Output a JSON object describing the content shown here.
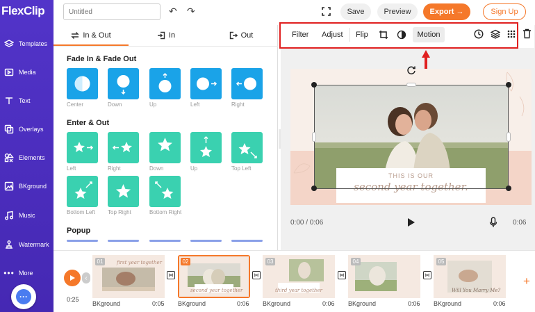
{
  "app": {
    "logo_text": "FlexClip"
  },
  "sidebar": {
    "items": [
      {
        "label": "Templates",
        "icon": "layers-icon"
      },
      {
        "label": "Media",
        "icon": "media-icon"
      },
      {
        "label": "Text",
        "icon": "text-icon"
      },
      {
        "label": "Overlays",
        "icon": "overlays-icon"
      },
      {
        "label": "Elements",
        "icon": "elements-icon"
      },
      {
        "label": "BKground",
        "icon": "background-icon"
      },
      {
        "label": "Music",
        "icon": "music-icon"
      },
      {
        "label": "Watermark",
        "icon": "watermark-icon"
      },
      {
        "label": "More",
        "icon": "more-icon"
      }
    ]
  },
  "topbar": {
    "title_placeholder": "Untitled",
    "save_label": "Save",
    "preview_label": "Preview",
    "export_label": "Export →",
    "signup_label": "Sign Up"
  },
  "panel": {
    "tabs": [
      "In & Out",
      "In",
      "Out"
    ],
    "sections": {
      "fade": "Fade In & Fade Out",
      "enter": "Enter & Out",
      "popup": "Popup"
    },
    "fade_items": [
      "Center",
      "Down",
      "Up",
      "Left",
      "Right"
    ],
    "enter_items": [
      "Left",
      "Right",
      "Down",
      "Up",
      "Top Left",
      "Bottom Left",
      "Top Right",
      "Bottom Right"
    ]
  },
  "toolbar": {
    "filter": "Filter",
    "adjust": "Adjust",
    "flip": "Flip",
    "motion": "Motion"
  },
  "canvas": {
    "caption_small": "THIS IS OUR",
    "caption_script": "second year together."
  },
  "player": {
    "time": "0:00 / 0:06",
    "duration": "0:06"
  },
  "timeline": {
    "total": "0:25",
    "clips": [
      {
        "num": "01",
        "label": "BKground",
        "time": "0:05",
        "caption": "first year together"
      },
      {
        "num": "02",
        "label": "BKground",
        "time": "0:06",
        "caption": "second year together"
      },
      {
        "num": "03",
        "label": "BKground",
        "time": "0:06",
        "caption": "third year together"
      },
      {
        "num": "04",
        "label": "BKground",
        "time": "0:06",
        "caption": ""
      },
      {
        "num": "05",
        "label": "BKground",
        "time": "0:06",
        "caption": "Will You Marry Me?"
      }
    ]
  },
  "colors": {
    "sidebar": "#4a2fbd",
    "accent_orange": "#f5782a",
    "tile_blue": "#1aa3e8",
    "tile_green": "#3ad1b0",
    "highlight_red": "#e02020"
  }
}
